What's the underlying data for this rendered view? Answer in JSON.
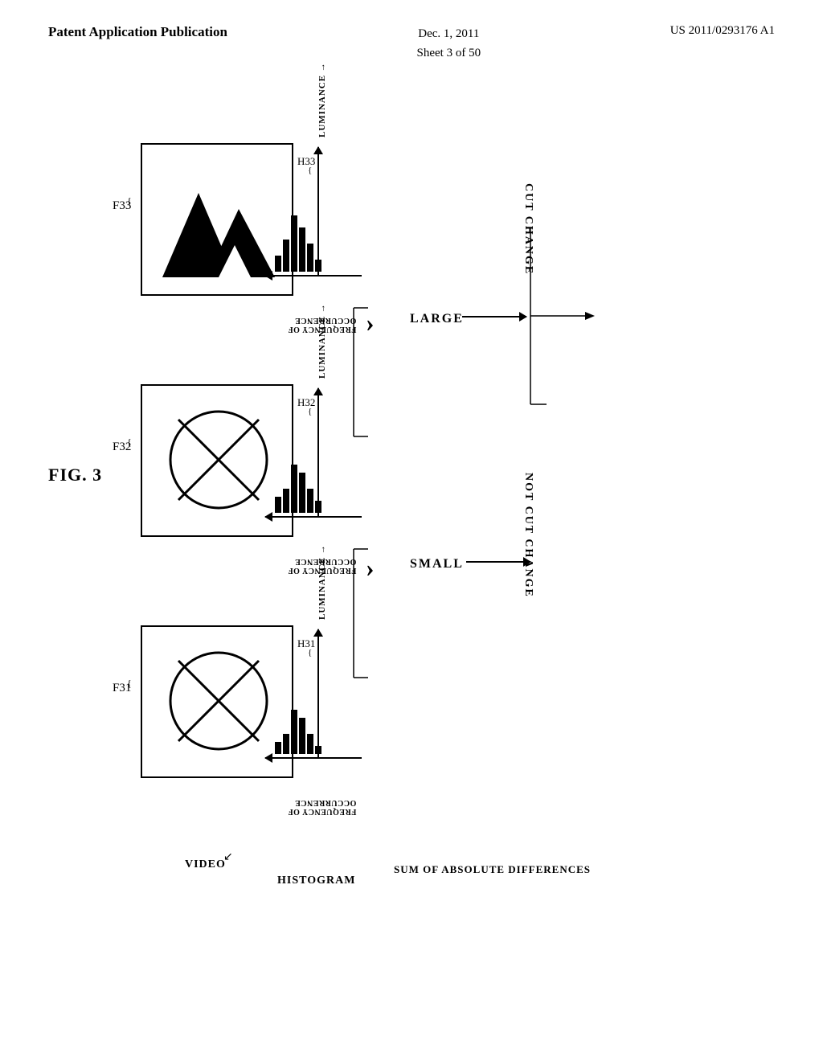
{
  "header": {
    "left": "Patent Application Publication",
    "center_date": "Dec. 1, 2011",
    "center_sheet": "Sheet 3 of 50",
    "right": "US 2011/0293176 A1"
  },
  "figure": {
    "label": "FIG. 3",
    "frames": [
      {
        "id": "F33",
        "label": "F33",
        "type": "triangle"
      },
      {
        "id": "F32",
        "label": "F32",
        "type": "circle-x"
      },
      {
        "id": "F31",
        "label": "F31",
        "type": "circle-x"
      }
    ],
    "histograms": [
      {
        "id": "H33",
        "label": "H33"
      },
      {
        "id": "H32",
        "label": "H32"
      },
      {
        "id": "H31",
        "label": "H31"
      }
    ],
    "axis_luminance": "LUMINANCE",
    "axis_frequency": "FREQUENCY OF\nOCCURRENCE",
    "comparison_large": "LARGE",
    "comparison_small": "SMALL",
    "result_cut": "CUT CHANGE",
    "result_not_cut": "NOT CUT CHANGE",
    "bottom_video": "VIDEO",
    "bottom_histogram": "HISTOGRAM",
    "bottom_sad": "SUM OF\nABSOLUTE\nDIFFERENCES"
  }
}
